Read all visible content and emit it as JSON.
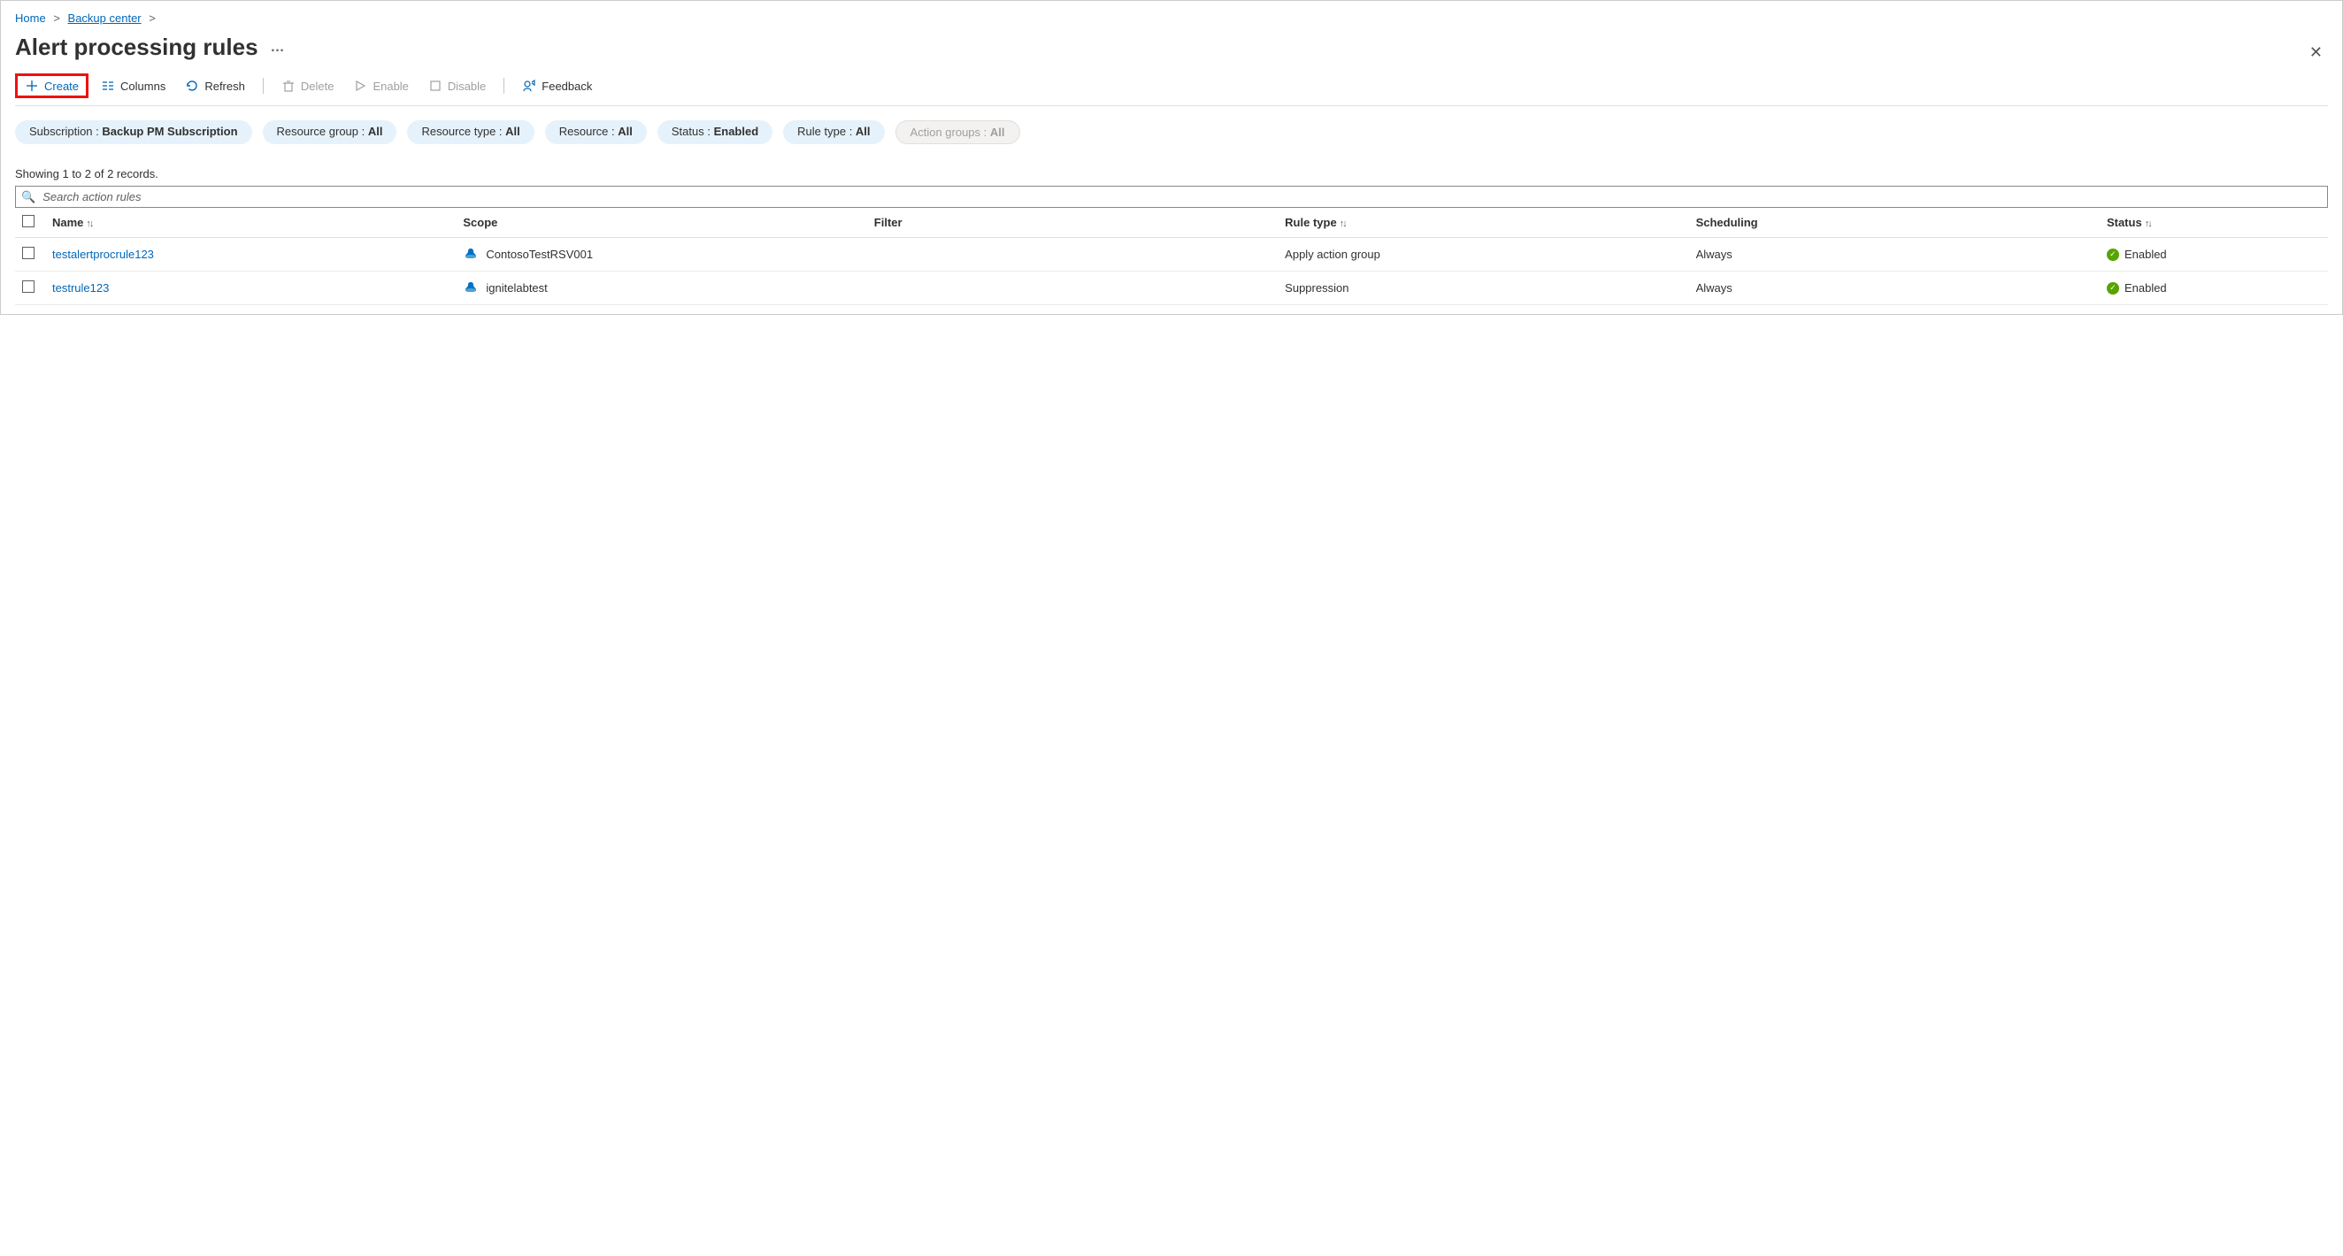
{
  "breadcrumb": {
    "home": "Home",
    "backup_center": "Backup center"
  },
  "page_title": "Alert processing rules",
  "toolbar": {
    "create": "Create",
    "columns": "Columns",
    "refresh": "Refresh",
    "delete": "Delete",
    "enable": "Enable",
    "disable": "Disable",
    "feedback": "Feedback"
  },
  "filters": {
    "subscription_label": "Subscription : ",
    "subscription_value": "Backup PM Subscription",
    "resource_group_label": "Resource group : ",
    "resource_group_value": "All",
    "resource_type_label": "Resource type : ",
    "resource_type_value": "All",
    "resource_label": "Resource : ",
    "resource_value": "All",
    "status_label": "Status : ",
    "status_value": "Enabled",
    "rule_type_label": "Rule type : ",
    "rule_type_value": "All",
    "action_groups_label": "Action groups : ",
    "action_groups_value": "All"
  },
  "records_line": "Showing 1 to 2 of 2 records.",
  "search_placeholder": "Search action rules",
  "columns": {
    "name": "Name",
    "scope": "Scope",
    "filter": "Filter",
    "rule_type": "Rule type",
    "scheduling": "Scheduling",
    "status": "Status"
  },
  "rows": [
    {
      "name": "testalertprocrule123",
      "scope": "ContosoTestRSV001",
      "filter": "",
      "rule_type": "Apply action group",
      "scheduling": "Always",
      "status": "Enabled"
    },
    {
      "name": "testrule123",
      "scope": "ignitelabtest",
      "filter": "",
      "rule_type": "Suppression",
      "scheduling": "Always",
      "status": "Enabled"
    }
  ]
}
